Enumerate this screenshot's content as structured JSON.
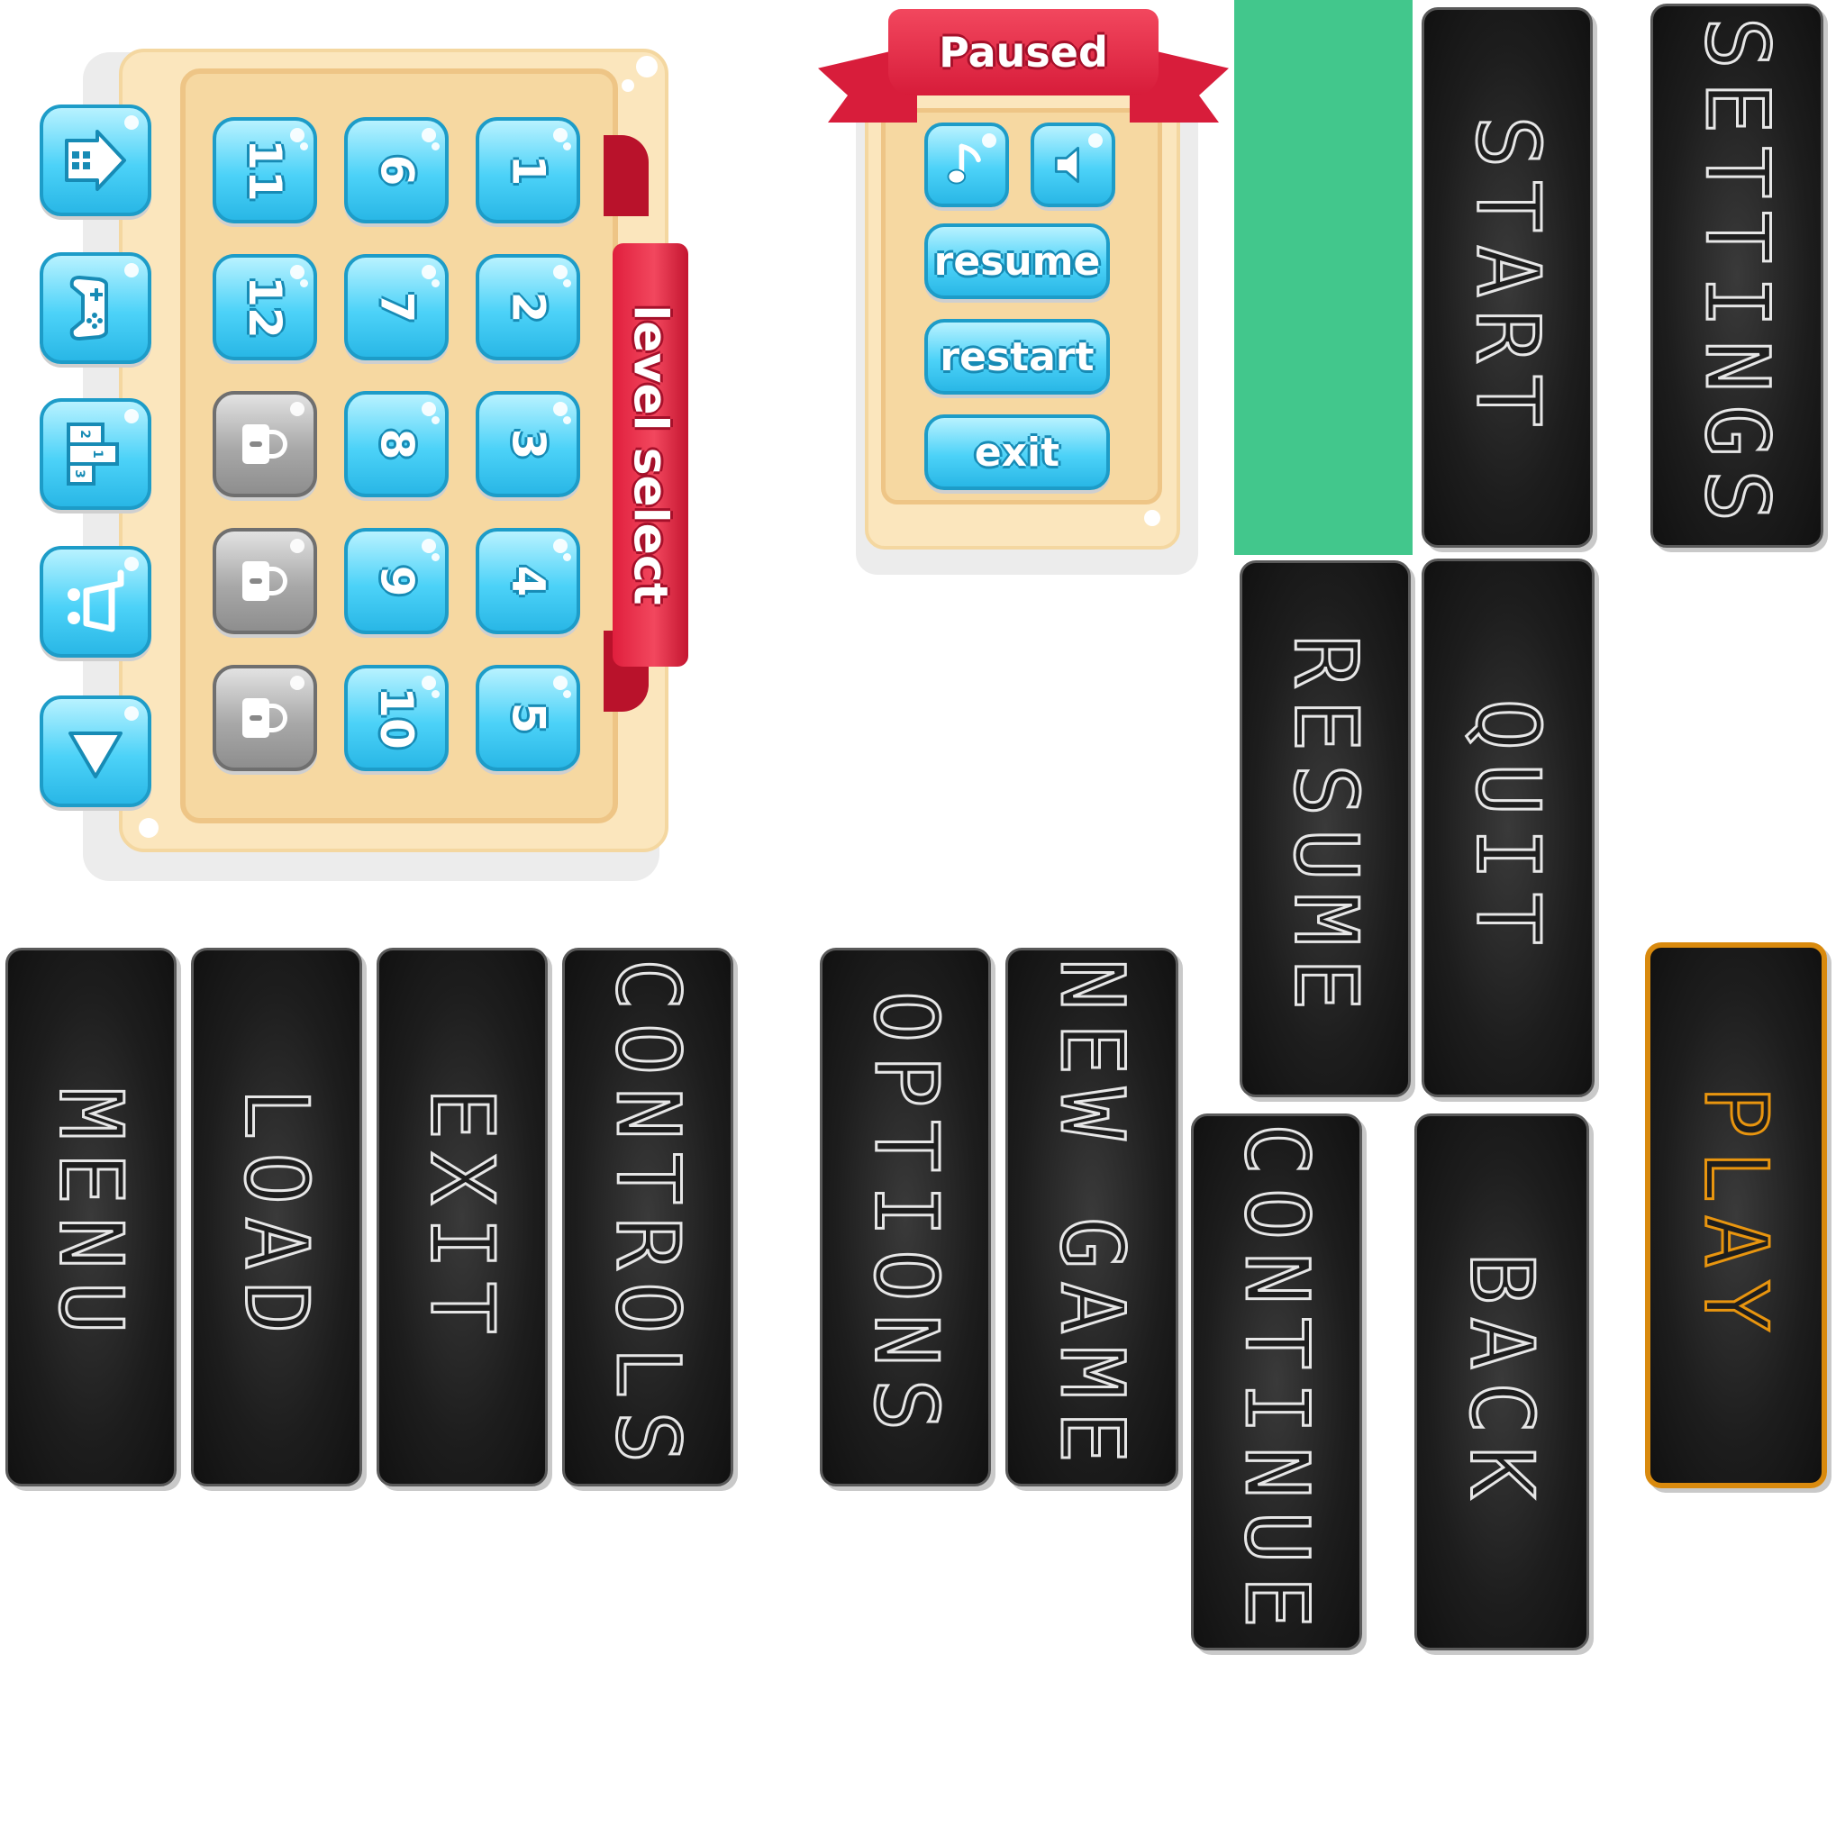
{
  "level_select": {
    "banner": "level select",
    "levels": [
      "1",
      "2",
      "3",
      "4",
      "5",
      "6",
      "7",
      "8",
      "9",
      "10",
      "11",
      "12"
    ],
    "locked_count": 3,
    "side_icons": [
      "home-icon",
      "gamepad-icon",
      "podium-icon",
      "cart-icon",
      "play-triangle-icon"
    ],
    "podium_numbers": [
      "2",
      "1",
      "3"
    ]
  },
  "paused": {
    "title": "Paused",
    "icons": [
      "music-note-icon",
      "speaker-icon"
    ],
    "buttons": {
      "resume": "resume",
      "restart": "restart",
      "exit": "exit"
    }
  },
  "chalk_buttons": {
    "start": "START",
    "settings": "SETTINGS",
    "resume": "RESUME",
    "quit": "QUIT",
    "menu": "MENU",
    "load": "LOAD",
    "exit": "EXIT",
    "controls": "CONTROLS",
    "options": "OPTIONS",
    "new_game": "NEW GAME",
    "continue": "CONTINUE",
    "back": "BACK",
    "play": "PLAY"
  },
  "colors": {
    "panel": "#fbe6bd",
    "tile_blue": "#4cd2f8",
    "ribbon_red": "#e01f3d",
    "green_block": "#42c78c",
    "chalkboard": "#1d1d1d",
    "play_accent": "#e8950f"
  }
}
